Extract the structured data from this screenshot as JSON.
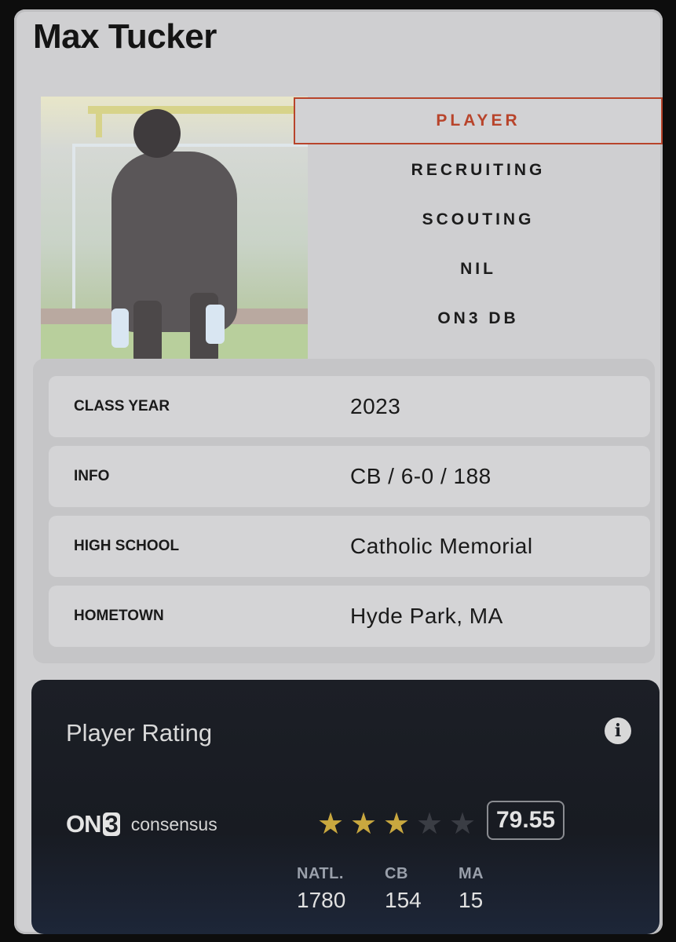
{
  "player": {
    "name": "Max Tucker"
  },
  "nav": {
    "items": [
      {
        "label": "PLAYER",
        "active": true
      },
      {
        "label": "RECRUITING",
        "active": false
      },
      {
        "label": "SCOUTING",
        "active": false
      },
      {
        "label": "NIL",
        "active": false
      },
      {
        "label": "ON3 DB",
        "active": false
      }
    ]
  },
  "details": [
    {
      "label": "CLASS YEAR",
      "value": "2023"
    },
    {
      "label": "INFO",
      "value": "CB / 6-0 / 188"
    },
    {
      "label": "HIGH SCHOOL",
      "value": "Catholic Memorial"
    },
    {
      "label": "HOMETOWN",
      "value": "Hyde Park, MA"
    }
  ],
  "rating": {
    "title": "Player Rating",
    "info_icon": "info-icon",
    "brand_prefix": "ON",
    "brand_number": "3",
    "brand_sub": "consensus",
    "stars": 3,
    "stars_max": 5,
    "score": "79.55",
    "ranks": [
      {
        "label": "NATL.",
        "value": "1780"
      },
      {
        "label": "CB",
        "value": "154"
      },
      {
        "label": "MA",
        "value": "15"
      }
    ]
  },
  "colors": {
    "accent": "#b8442b",
    "star_on": "#c9a83f",
    "card_bg": "#1c1f26"
  }
}
